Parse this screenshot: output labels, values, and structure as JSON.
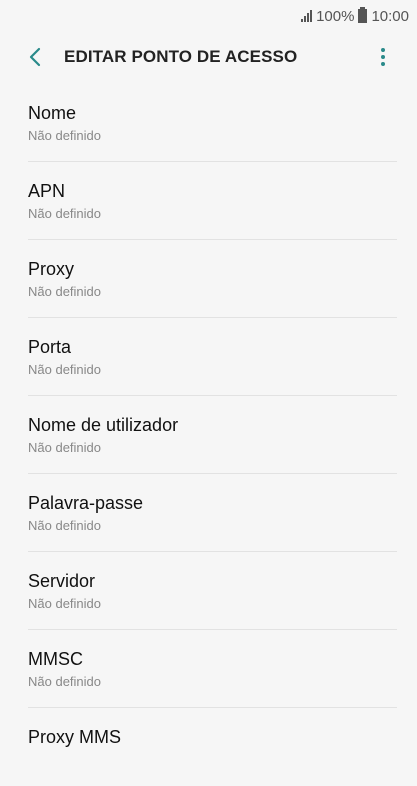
{
  "status_bar": {
    "battery": "100%",
    "time": "10:00"
  },
  "header": {
    "title": "EDITAR PONTO DE ACESSO",
    "accent_color": "#2a8a8a"
  },
  "settings": {
    "items": [
      {
        "label": "Nome",
        "value": "Não definido"
      },
      {
        "label": "APN",
        "value": "Não definido"
      },
      {
        "label": "Proxy",
        "value": "Não definido"
      },
      {
        "label": "Porta",
        "value": "Não definido"
      },
      {
        "label": "Nome de utilizador",
        "value": "Não definido"
      },
      {
        "label": "Palavra-passe",
        "value": "Não definido"
      },
      {
        "label": "Servidor",
        "value": "Não definido"
      },
      {
        "label": "MMSC",
        "value": "Não definido"
      },
      {
        "label": "Proxy MMS",
        "value": ""
      }
    ]
  }
}
